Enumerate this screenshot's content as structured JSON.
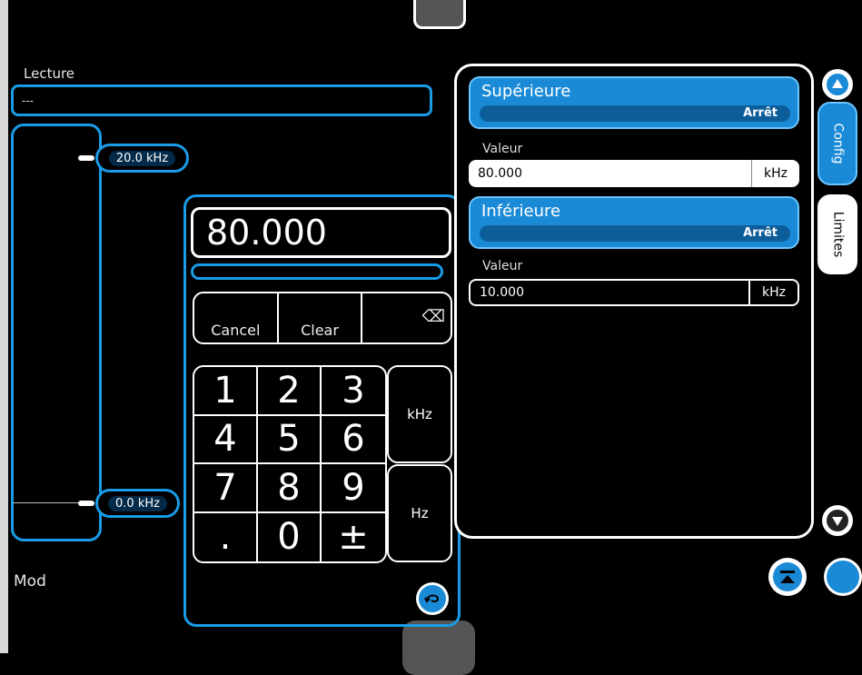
{
  "lecture": {
    "label": "Lecture",
    "value": "---"
  },
  "gauge": {
    "upper_label": "20.0 kHz",
    "lower_label": "0.0 kHz"
  },
  "mod_label": "Mod",
  "numpad": {
    "display_value": "80.000",
    "cancel_label": "Cancel",
    "clear_label": "Clear",
    "backspace_icon": "⌫",
    "keys": [
      "1",
      "2",
      "3",
      "4",
      "5",
      "6",
      "7",
      "8",
      "9",
      ".",
      "0",
      "±"
    ],
    "unit_khz": "kHz",
    "unit_hz": "Hz"
  },
  "limits": {
    "upper": {
      "title": "Supérieure",
      "state": "Arrêt",
      "valeur_label": "Valeur",
      "value": "80.000",
      "unit": "kHz"
    },
    "lower": {
      "title": "Inférieure",
      "state": "Arrêt",
      "valeur_label": "Valeur",
      "value": "10.000",
      "unit": "kHz"
    }
  },
  "tabs": {
    "config": "Config",
    "limites": "Limites"
  },
  "colors": {
    "accent": "#1a9be6",
    "header": "#1a8ad6",
    "background": "#000000"
  }
}
